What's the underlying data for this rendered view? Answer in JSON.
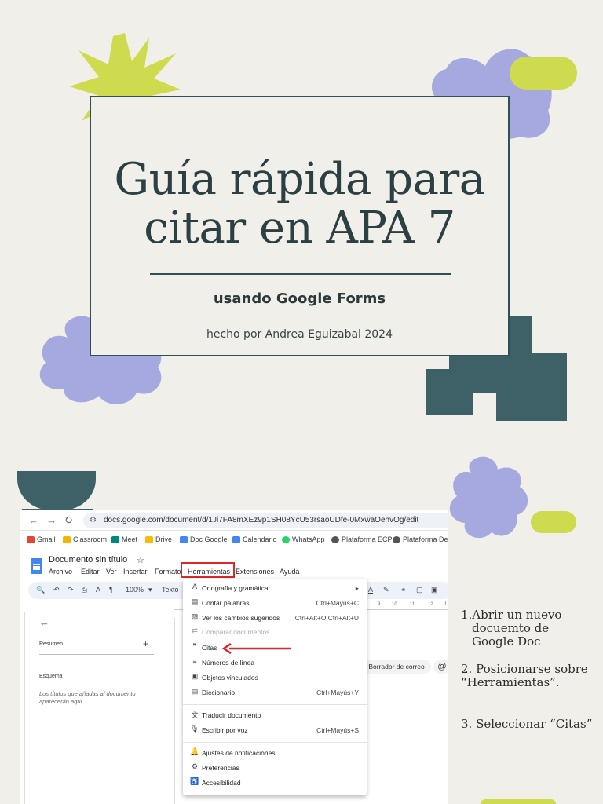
{
  "colors": {
    "background": "#f1efe9",
    "teal": "#3d6166",
    "lavender": "#a6a9df",
    "lime": "#cedb4f",
    "highlight_red": "#e02626"
  },
  "cover": {
    "title_line1": "Guía rápida para",
    "title_line2": "citar en APA 7",
    "subtitle": "usando Google Forms",
    "author": "hecho por Andrea Eguizabal 2024"
  },
  "browser": {
    "url": "docs.google.com/document/d/1Ji7FA8mXEz9p1SH08YcU53rsaoUDfe-0MxwaOehvOg/edit",
    "nav_icons": [
      "back-icon",
      "forward-icon",
      "reload-icon"
    ],
    "bookmarks": [
      {
        "label": "Gmail",
        "color": "#ea4335"
      },
      {
        "label": "Classroom",
        "color": "#f4b400"
      },
      {
        "label": "Meet",
        "color": "#00897b"
      },
      {
        "label": "Drive",
        "color": "#fbbc04"
      },
      {
        "label": "Doc Google",
        "color": "#4285f4"
      },
      {
        "label": "Calendario",
        "color": "#4285f4"
      },
      {
        "label": "WhatsApp",
        "color": "#25d366"
      },
      {
        "label": "Plataforma ECP",
        "color": "#555555"
      },
      {
        "label": "Plataforma Dere",
        "color": "#555555"
      }
    ]
  },
  "doc": {
    "title": "Documento sin título",
    "menu": [
      "Archivo",
      "Editar",
      "Ver",
      "Insertar",
      "Formato",
      "Herramientas",
      "Extensiones",
      "Ayuda"
    ],
    "zoom": "100%",
    "text_style": "Texto",
    "ruler_ticks": [
      "9",
      "10",
      "11",
      "12",
      "1"
    ],
    "sidebar": {
      "resumen": "Resumen",
      "esquema": "Esquema",
      "esquema_note": "Los títulos que añadas al documento aparecerán aquí."
    },
    "chip_label": "Borrador de correo",
    "chip_at": "@"
  },
  "tools_menu": {
    "items": [
      {
        "icon": "spellcheck-icon",
        "glyph": "A̲",
        "label": "Ortografía y gramática",
        "shortcut": "▸",
        "disabled": false
      },
      {
        "icon": "word-count-icon",
        "glyph": "▤",
        "label": "Contar palabras",
        "shortcut": "Ctrl+Mayús+C",
        "disabled": false
      },
      {
        "icon": "suggested-changes-icon",
        "glyph": "▧",
        "label": "Ver los cambios sugeridos",
        "shortcut": "Ctrl+Alt+O Ctrl+Alt+U",
        "disabled": false
      },
      {
        "icon": "compare-icon",
        "glyph": "⇄",
        "label": "Comparar documentos",
        "shortcut": "",
        "disabled": true
      },
      {
        "icon": "citations-icon",
        "glyph": "❞",
        "label": "Citas",
        "shortcut": "",
        "disabled": false
      },
      {
        "icon": "line-numbers-icon",
        "glyph": "≡",
        "label": "Números de línea",
        "shortcut": "",
        "disabled": false
      },
      {
        "icon": "linked-objects-icon",
        "glyph": "▣",
        "label": "Objetos vinculados",
        "shortcut": "",
        "disabled": false
      },
      {
        "icon": "dictionary-icon",
        "glyph": "▤",
        "label": "Diccionario",
        "shortcut": "Ctrl+Mayús+Y",
        "disabled": false
      },
      {
        "icon": "translate-icon",
        "glyph": "文",
        "label": "Traducir documento",
        "shortcut": "",
        "disabled": false
      },
      {
        "icon": "voice-typing-icon",
        "glyph": "🎙",
        "label": "Escribir por voz",
        "shortcut": "Ctrl+Mayús+S",
        "disabled": false
      },
      {
        "icon": "notifications-icon",
        "glyph": "🔔",
        "label": "Ajustes de notificaciones",
        "shortcut": "",
        "disabled": false
      },
      {
        "icon": "preferences-icon",
        "glyph": "⚙",
        "label": "Preferencias",
        "shortcut": "",
        "disabled": false
      },
      {
        "icon": "accessibility-icon",
        "glyph": "♿",
        "label": "Accesibilidad",
        "shortcut": "",
        "disabled": false
      }
    ]
  },
  "instructions": {
    "step1": "1.Abrir un nuevo docuemto de Google Doc",
    "step2": "2. Posicionarse sobre “Herramientas”.",
    "step3": "3. Seleccionar “Citas”"
  }
}
